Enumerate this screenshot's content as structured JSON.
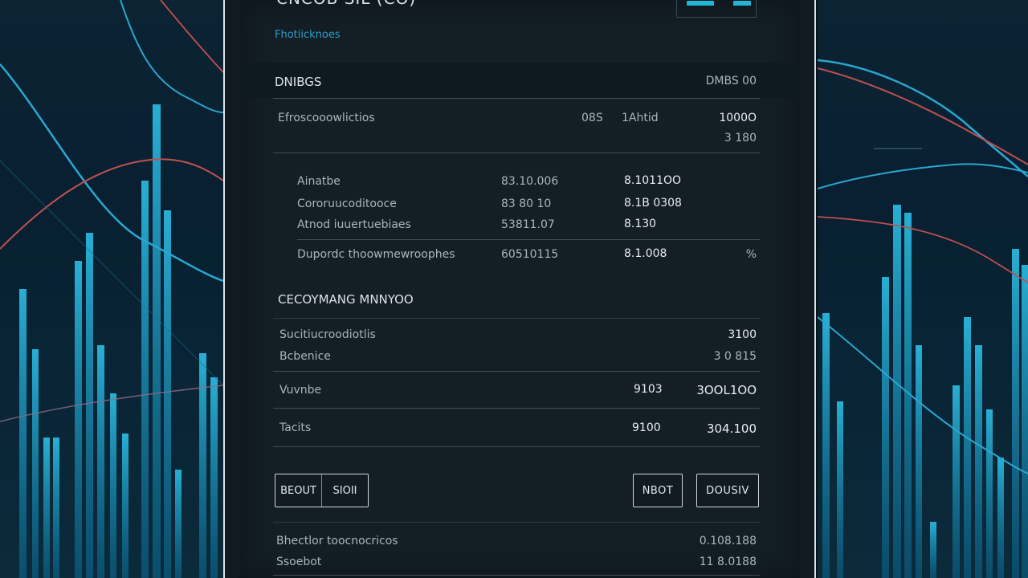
{
  "header": {
    "title": "CNCOB SIL (CO)",
    "subtitle": "Fhotiicknoes"
  },
  "table_header": {
    "label": "DNIBGS",
    "value": "DMBS 00"
  },
  "summary_row": {
    "label": "Efroscooowlictios",
    "col_a": "08S",
    "col_b": "1Ahtid",
    "value_1": "1000O",
    "value_2": "3 180"
  },
  "details": [
    {
      "label": "Ainatbe",
      "value_a": "83.10.006",
      "value_b": "8.1011OO"
    },
    {
      "label": "Cororuucoditooce",
      "value_a": "83 80 10",
      "value_b": "8.1B 0308"
    },
    {
      "label": "Atnod iuuertuebiaes",
      "value_a": "53811.07",
      "value_b": "8.130"
    }
  ],
  "detail_total": {
    "label": "Dupordc thoowmewroophes",
    "value_a": "60510115",
    "value_b": "8.1.008",
    "flag": "%"
  },
  "section2": {
    "title": "CECOYMANG MNNYOO",
    "rows": [
      {
        "label": "Sucitiucroodiotlis",
        "value": "3100"
      },
      {
        "label": "Bcbenice",
        "value": "3 0 815"
      }
    ]
  },
  "totals": [
    {
      "label": "Vuvnbe",
      "value_a": "9103",
      "value_b": "3OOL1OO"
    },
    {
      "label": "Tacits",
      "value_a": "9100",
      "value_b": "304.100"
    }
  ],
  "buttons": {
    "seg_left": "BEOUT",
    "seg_right": "SIOII",
    "mid": "NBOT",
    "right": "DOUSIV"
  },
  "footer": [
    {
      "label": "Bhectlor toocnocricos",
      "value": "0.108.188"
    },
    {
      "label": "Ssoebot",
      "value": "11 8.0188"
    }
  ],
  "colors": {
    "accent": "#22b6d6",
    "panel": "#131e25",
    "text": "#c8d2d8"
  }
}
